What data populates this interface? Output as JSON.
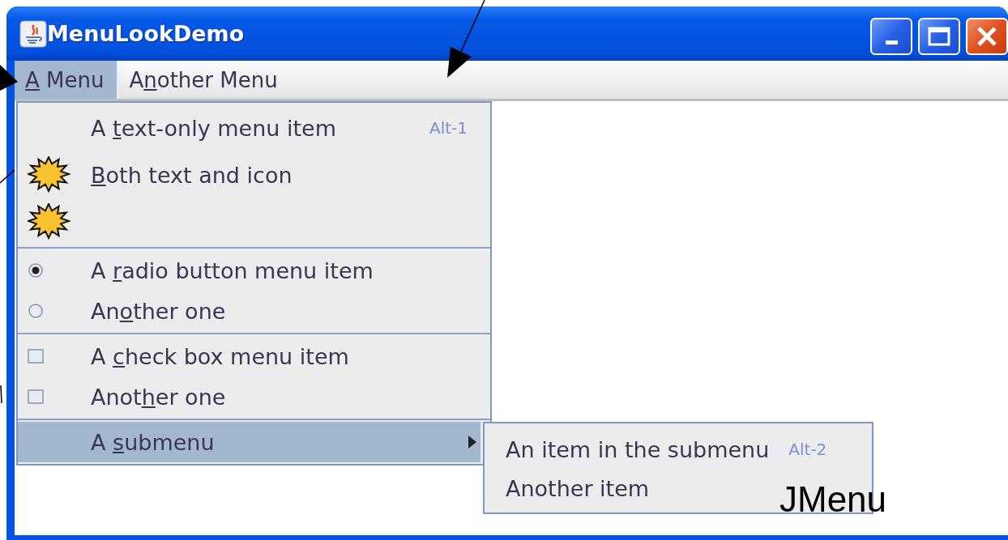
{
  "window": {
    "title": "MenuLookDemo"
  },
  "menu_bar": [
    {
      "mnemonic": "A",
      "label_after": " Menu",
      "selected": true
    },
    {
      "label_before": "A",
      "mnemonic": "n",
      "label_after": "other Menu",
      "selected": false
    }
  ],
  "menu": {
    "groups": [
      {
        "items": [
          {
            "kind": "text",
            "label_before": "A ",
            "mnemonic": "t",
            "label_after": "ext-only menu item",
            "accelerator": "Alt-1",
            "selected": false
          },
          {
            "kind": "icon",
            "mnemonic": "B",
            "label_after": "oth text and icon",
            "selected": false
          },
          {
            "kind": "icon",
            "selected": false
          }
        ]
      },
      {
        "items": [
          {
            "kind": "radio",
            "label_before": "A ",
            "mnemonic": "r",
            "label_after": "adio button menu item",
            "checked": true,
            "selected": false
          },
          {
            "kind": "radio",
            "label_before": "An",
            "mnemonic": "o",
            "label_after": "ther one",
            "checked": false,
            "selected": false
          }
        ]
      },
      {
        "items": [
          {
            "kind": "checkbox",
            "label_before": "A ",
            "mnemonic": "c",
            "label_after": "heck box menu item",
            "checked": false,
            "selected": false
          },
          {
            "kind": "checkbox",
            "label_before": "Anot",
            "mnemonic": "h",
            "label_after": "er one",
            "checked": false,
            "selected": false
          }
        ]
      },
      {
        "items": [
          {
            "kind": "submenu",
            "label_before": "A ",
            "mnemonic": "s",
            "label_after": "ubmenu",
            "selected": true
          }
        ]
      }
    ]
  },
  "submenu": {
    "items": [
      {
        "label": "An item in the submenu",
        "accelerator": "Alt-2",
        "selected": false
      },
      {
        "label": "Another item",
        "selected": false
      }
    ]
  },
  "annotation": {
    "text": "JMenu"
  }
}
